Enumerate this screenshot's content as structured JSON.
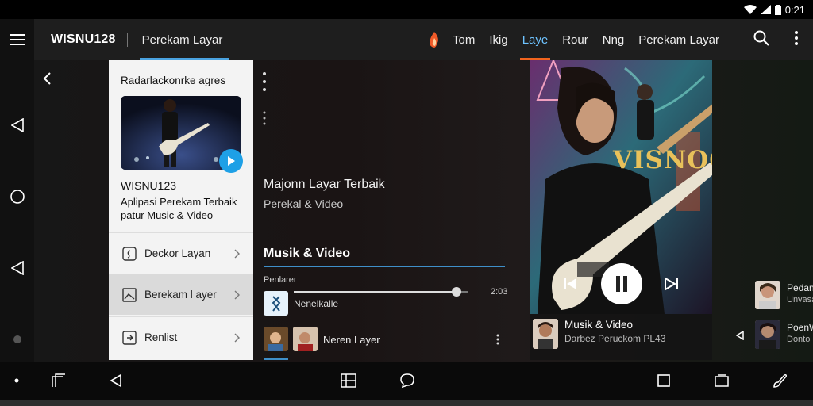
{
  "status_bar": {
    "time": "0:21"
  },
  "app_bar": {
    "title": "WISNU128",
    "subtitle": "Perekam Layar",
    "tabs": [
      {
        "label": "Tom"
      },
      {
        "label": "Ikig"
      },
      {
        "label": "Laye",
        "active": true
      },
      {
        "label": "Rour"
      },
      {
        "label": "Nng"
      },
      {
        "label": "Perekam Layar"
      }
    ]
  },
  "side_card": {
    "header": "Radarlackonrke agres",
    "title": "WISNU123",
    "description": "Aplipasi Perekam Terbaik patur Music & Video",
    "menu": [
      {
        "label": "Deckor Layan",
        "icon": "screen-record-icon"
      },
      {
        "label": "Berekam l ayer",
        "icon": "image-frame-icon",
        "selected": true
      },
      {
        "label": "Renlist",
        "icon": "export-icon"
      }
    ]
  },
  "middle": {
    "title": "Majonn Layar Terbaik",
    "subtitle": "Perekal & Video",
    "section_title": "Musik & Video",
    "now_label": "Penlarer",
    "progress": 0.93,
    "time": "2:03",
    "track1_label": "Nenelkalle",
    "track2_label": "Neren Layer"
  },
  "player": {
    "brand": "VISNOC",
    "now_playing_title": "Musik & Video",
    "now_playing_artist": "Darbez Peruckom PL43"
  },
  "queue": [
    {
      "title": "Pedan",
      "sub": "Unvasa"
    },
    {
      "title": "PoenW",
      "sub": "Donto"
    }
  ],
  "colors": {
    "accent_blue": "#1ea0e6",
    "active_tab_underline": "#f0641e",
    "card_background": "#f3f3f3"
  }
}
